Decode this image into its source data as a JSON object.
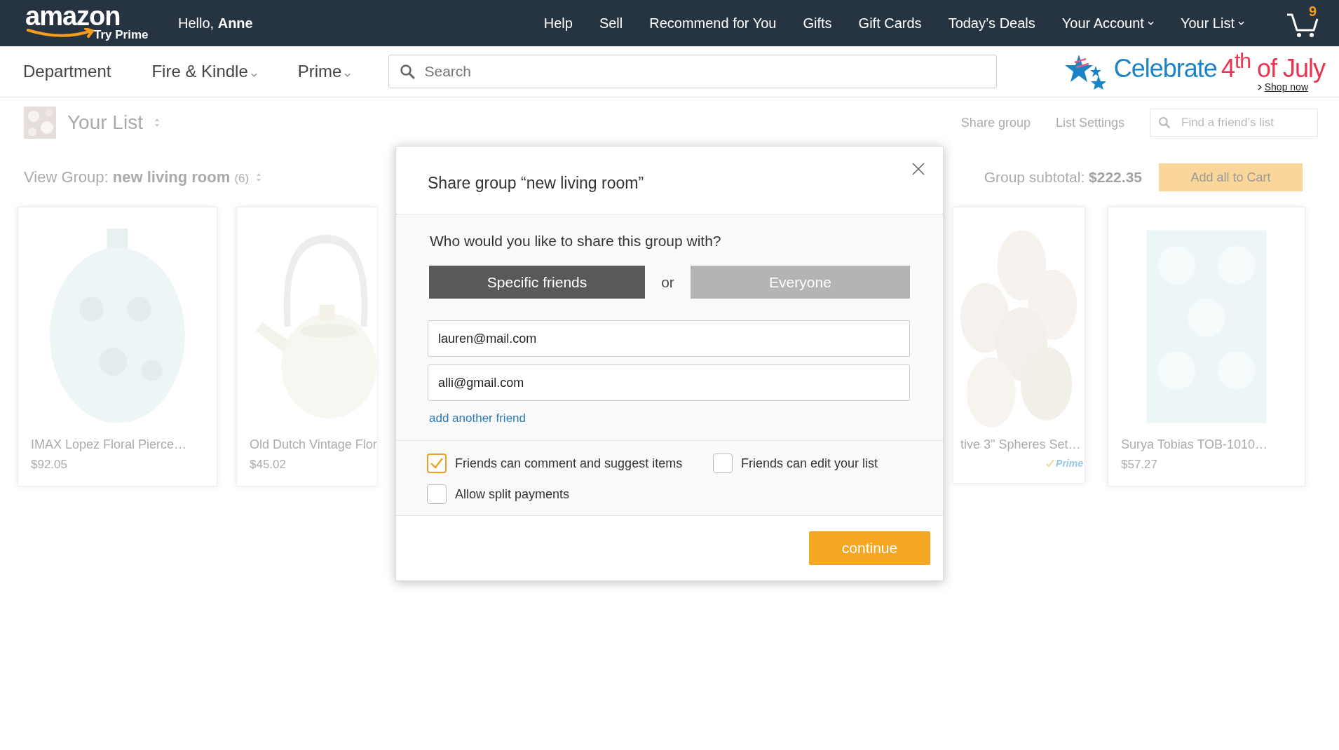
{
  "header": {
    "logo": "amazon",
    "logo_sub": "Try Prime",
    "greeting": "Hello,",
    "user": "Anne",
    "nav": [
      {
        "label": "Help",
        "dropdown": false
      },
      {
        "label": "Sell",
        "dropdown": false
      },
      {
        "label": "Recommend for You",
        "dropdown": false
      },
      {
        "label": "Gifts",
        "dropdown": false
      },
      {
        "label": "Gift Cards",
        "dropdown": false
      },
      {
        "label": "Today’s Deals",
        "dropdown": false
      },
      {
        "label": "Your Account",
        "dropdown": true
      },
      {
        "label": "Your List",
        "dropdown": true
      }
    ],
    "cart_count": "9"
  },
  "subnav": {
    "items": [
      {
        "label": "Department",
        "dropdown": false
      },
      {
        "label": "Fire & Kindle",
        "dropdown": true
      },
      {
        "label": "Prime",
        "dropdown": true
      }
    ],
    "search": {
      "placeholder": "Search"
    },
    "promo": {
      "text": "Celebrate",
      "highlight": "4$^{th}$ of July",
      "link": "Shop now"
    }
  },
  "list_page": {
    "title": "Your List",
    "actions": [
      "Share group",
      "List Settings"
    ],
    "friend_search": {
      "placeholder": "Find a friend’s list"
    },
    "group_label": "View Group:",
    "group_name": "new living room",
    "group_count": "(6)",
    "subtotal_label": "Group subtotal:",
    "subtotal": "$222.35",
    "add_all": "Add all to Cart",
    "items": [
      {
        "title": "IMAX Lopez Floral Pierce…",
        "price": "$92.05"
      },
      {
        "title": "Old Dutch Vintage Flor",
        "price": "$45.02"
      },
      {
        "title": "tive 3\" Spheres Set…",
        "badge": "Prime"
      },
      {
        "title": "Surya Tobias TOB-1010…",
        "price": "$57.27"
      }
    ]
  },
  "dialog": {
    "title": "Share group “new living room”",
    "question": "Who would you like to share this group with?",
    "audience": [
      {
        "label": "Specific friends",
        "selected": true
      },
      {
        "label": "Everyone",
        "selected": false
      }
    ],
    "or": "or",
    "emails": [
      "lauren@mail.com",
      "alli@gmail.com"
    ],
    "add_link": "add another friend",
    "options": [
      {
        "label": "Friends can comment and suggest items",
        "checked": true
      },
      {
        "label": "Friends can edit your list",
        "checked": false
      },
      {
        "label": "Allow split payments",
        "checked": false
      }
    ],
    "continue": "continue"
  }
}
